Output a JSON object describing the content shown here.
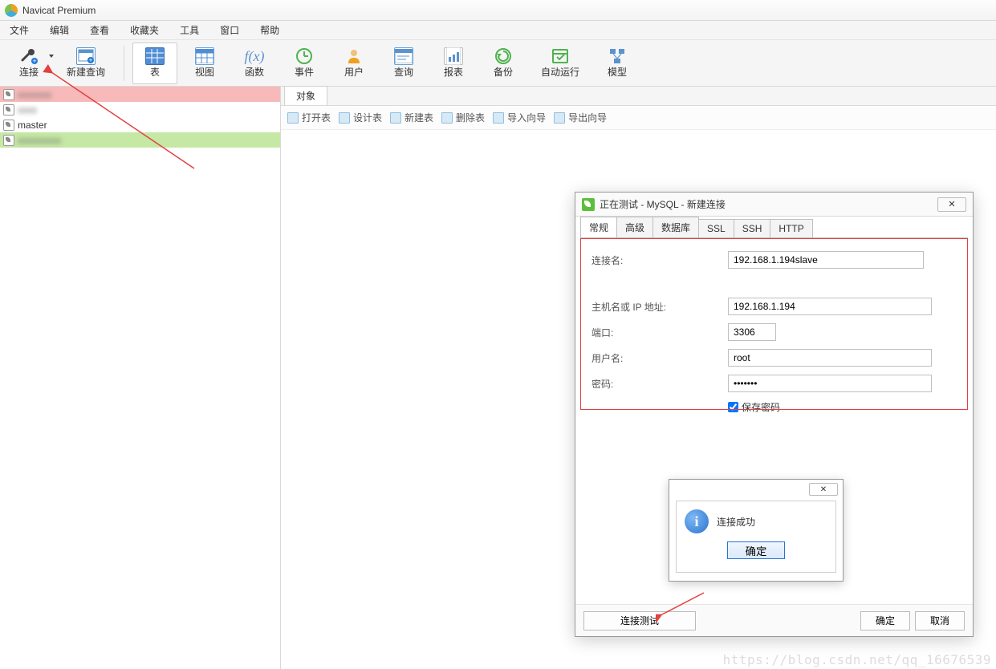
{
  "window": {
    "title": "Navicat Premium"
  },
  "menu": [
    "文件",
    "编辑",
    "查看",
    "收藏夹",
    "工具",
    "窗口",
    "帮助"
  ],
  "toolbar": [
    {
      "id": "connect",
      "label": "连接"
    },
    {
      "id": "new-query",
      "label": "新建查询"
    },
    {
      "id": "table",
      "label": "表",
      "active": true
    },
    {
      "id": "view",
      "label": "视图"
    },
    {
      "id": "function",
      "label": "函数"
    },
    {
      "id": "event",
      "label": "事件"
    },
    {
      "id": "user",
      "label": "用户"
    },
    {
      "id": "query",
      "label": "查询"
    },
    {
      "id": "report",
      "label": "报表"
    },
    {
      "id": "backup",
      "label": "备份"
    },
    {
      "id": "autorun",
      "label": "自动运行"
    },
    {
      "id": "model",
      "label": "模型"
    }
  ],
  "sidebar": {
    "items": [
      {
        "label": "",
        "variant": "pink",
        "blurred": true
      },
      {
        "label": "",
        "variant": "white",
        "blurred": true
      },
      {
        "label": "master",
        "variant": "white"
      },
      {
        "label": "",
        "variant": "green",
        "blurred": true
      }
    ]
  },
  "object_tab": {
    "label": "对象"
  },
  "subtoolbar": [
    "打开表",
    "设计表",
    "新建表",
    "删除表",
    "导入向导",
    "导出向导"
  ],
  "dialog": {
    "title": "正在测试 - MySQL - 新建连接",
    "tabs": [
      "常规",
      "高级",
      "数据库",
      "SSL",
      "SSH",
      "HTTP"
    ],
    "active_tab": 0,
    "fields": {
      "conn_name_label": "连接名:",
      "conn_name_value": "192.168.1.194slave",
      "host_label": "主机名或 IP 地址:",
      "host_value": "192.168.1.194",
      "port_label": "端口:",
      "port_value": "3306",
      "user_label": "用户名:",
      "user_value": "root",
      "pass_label": "密码:",
      "pass_value": "•••••••",
      "save_pass_label": "保存密码"
    },
    "footer": {
      "test": "连接测试",
      "ok": "确定",
      "cancel": "取消"
    }
  },
  "msgbox": {
    "text": "连接成功",
    "ok": "确定"
  },
  "watermark": "https://blog.csdn.net/qq_16676539"
}
